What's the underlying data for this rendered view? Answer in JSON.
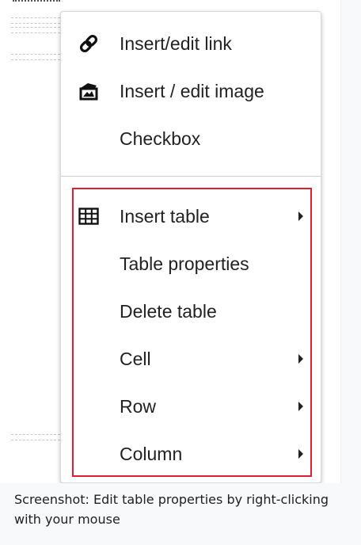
{
  "context_menu": {
    "items": [
      {
        "label": "Insert/edit link",
        "icon": "link-icon",
        "has_submenu": false
      },
      {
        "label": "Insert / edit image",
        "icon": "image-icon",
        "has_submenu": false
      },
      {
        "label": "Checkbox",
        "icon": "",
        "has_submenu": false
      },
      {
        "label": "Insert table",
        "icon": "table-grid-icon",
        "has_submenu": true
      },
      {
        "label": "Table properties",
        "icon": "",
        "has_submenu": false
      },
      {
        "label": "Delete table",
        "icon": "",
        "has_submenu": false
      },
      {
        "label": "Cell",
        "icon": "",
        "has_submenu": true
      },
      {
        "label": "Row",
        "icon": "",
        "has_submenu": true
      },
      {
        "label": "Column",
        "icon": "",
        "has_submenu": true
      }
    ]
  },
  "highlight_color": "#e0202f",
  "caption": "Screenshot: Edit table properties by right-clicking with your mouse"
}
